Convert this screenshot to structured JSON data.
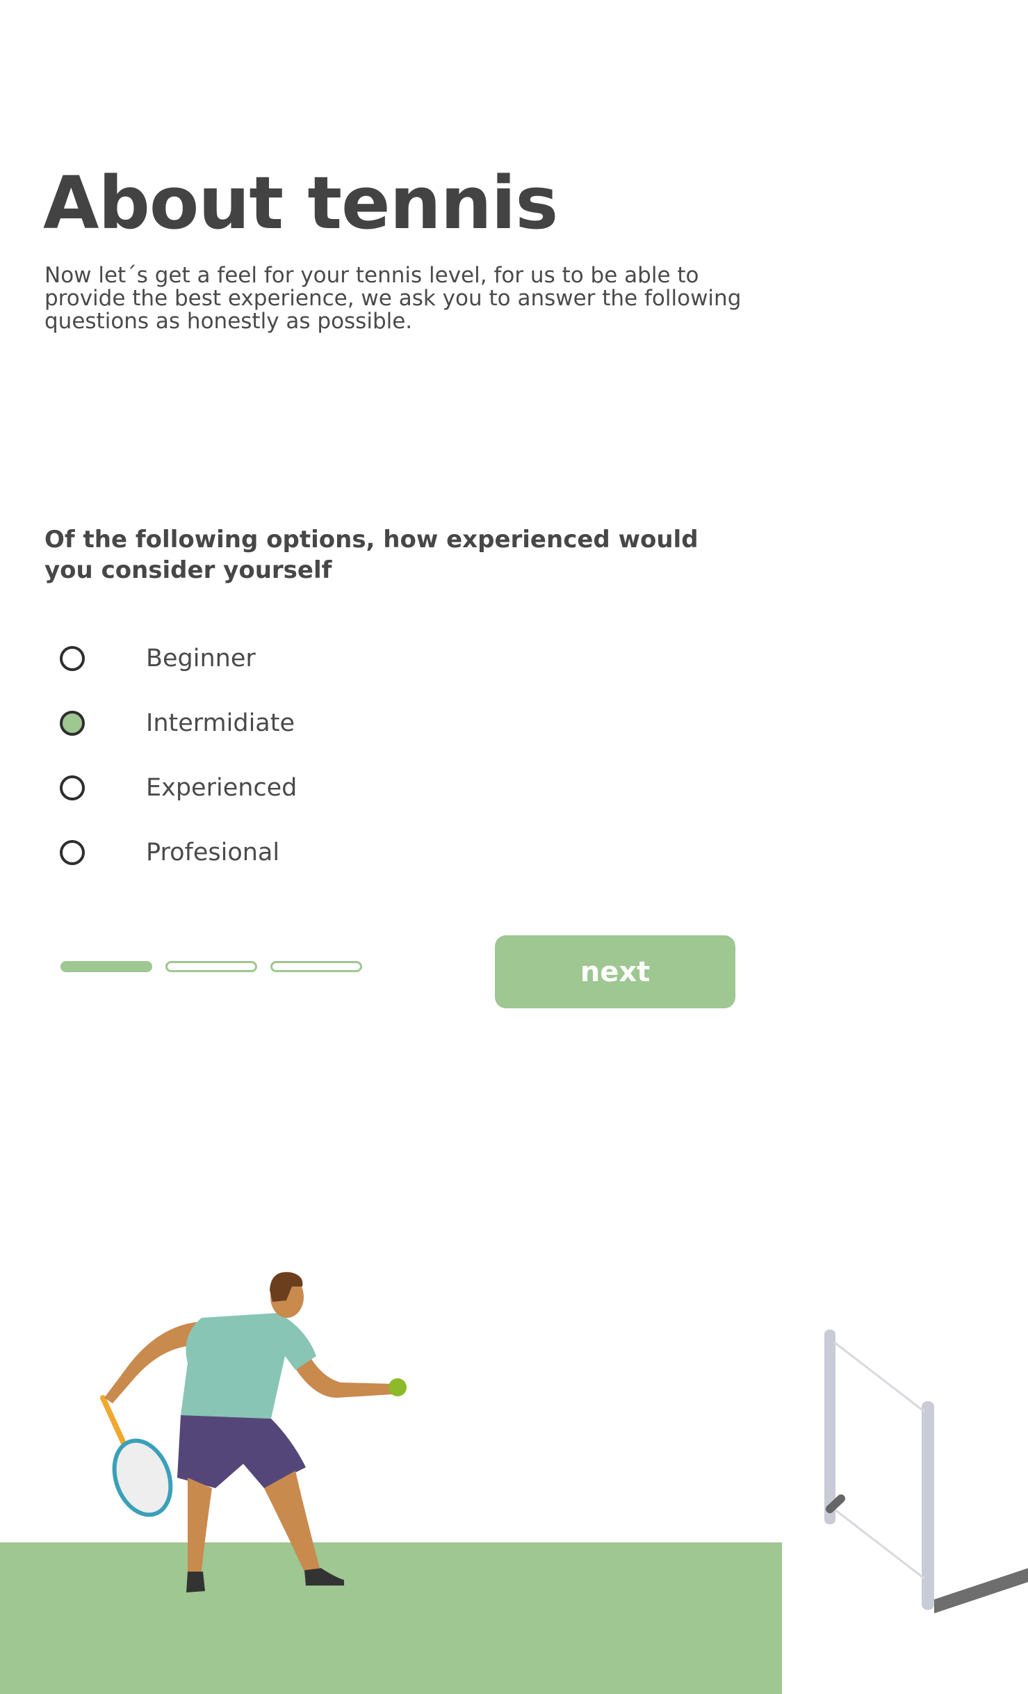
{
  "header": {
    "title": "About tennis",
    "intro": "Now let´s get a feel for your tennis level, for us to be able to provide the best experience, we ask you to answer the following questions as honestly as possible."
  },
  "question": {
    "text": "Of the following options, how experienced would you consider yourself",
    "options": [
      {
        "label": "Beginner",
        "selected": false
      },
      {
        "label": "Intermidiate",
        "selected": true
      },
      {
        "label": "Experienced",
        "selected": false
      },
      {
        "label": "Profesional",
        "selected": false
      }
    ]
  },
  "progress": {
    "current_step": 1,
    "total_steps": 3
  },
  "actions": {
    "next_label": "next"
  },
  "colors": {
    "accent": "#9ec791",
    "text": "#434343",
    "radio_border": "#2e2e2e"
  }
}
